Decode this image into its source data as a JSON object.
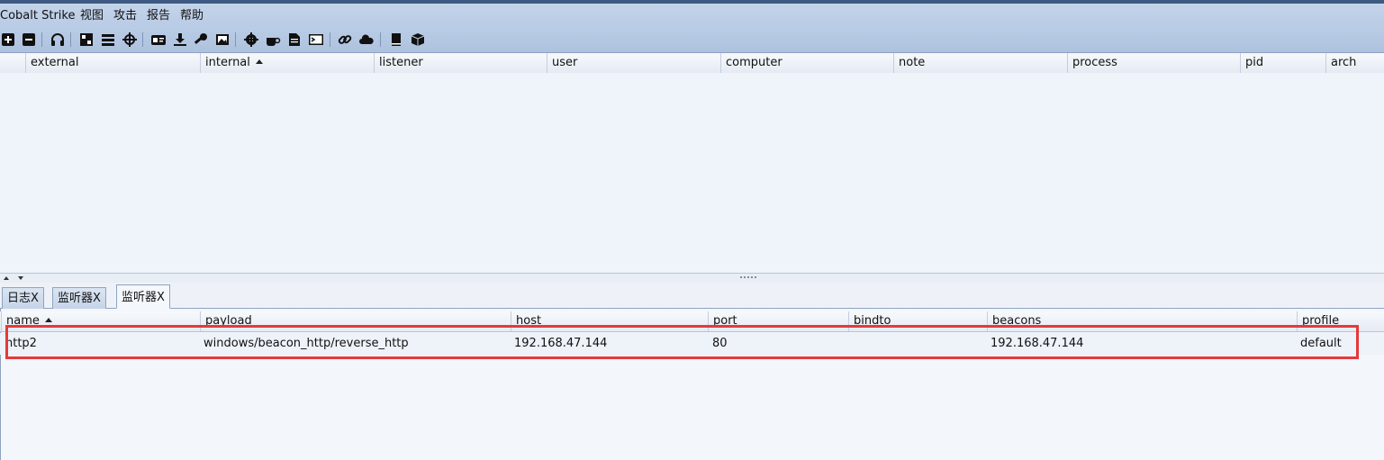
{
  "menu": {
    "app": "Cobalt Strike",
    "items": [
      "视图",
      "攻击",
      "报告",
      "帮助"
    ]
  },
  "toolbar": {
    "icons": [
      "plus-icon",
      "minus-icon",
      "headphones-icon",
      "network-icon",
      "list-icon",
      "crosshair-icon",
      "id-card-icon",
      "download-icon",
      "key-icon",
      "image-icon",
      "gear-icon",
      "coffee-icon",
      "document-icon",
      "terminal-icon",
      "link-icon",
      "cloud-icon",
      "book-icon",
      "cube-icon"
    ]
  },
  "beacons_table": {
    "columns": [
      "external",
      "internal",
      "listener",
      "user",
      "computer",
      "note",
      "process",
      "pid",
      "arch"
    ],
    "sorted_column": "internal",
    "rows": []
  },
  "tabs": [
    {
      "label": "日志X",
      "active": false
    },
    {
      "label": "监听器X",
      "active": false
    },
    {
      "label": "监听器X",
      "active": true
    }
  ],
  "listeners_table": {
    "columns": [
      "name",
      "payload",
      "host",
      "port",
      "bindto",
      "beacons",
      "profile"
    ],
    "sorted_column": "name",
    "rows": [
      {
        "name": "http2",
        "payload": "windows/beacon_http/reverse_http",
        "host": "192.168.47.144",
        "port": "80",
        "bindto": "",
        "beacons": "192.168.47.144",
        "profile": "default"
      }
    ]
  },
  "colors": {
    "highlight": "#e5393b",
    "menubar": "#c4d4ea"
  }
}
